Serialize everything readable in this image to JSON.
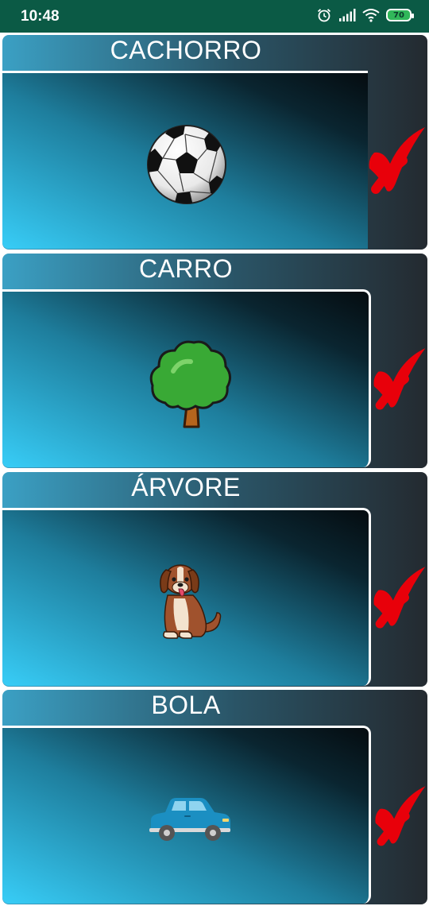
{
  "status_bar": {
    "time": "10:48",
    "battery_level": "70",
    "icons": [
      "alarm-icon",
      "signal-icon",
      "wifi-icon",
      "battery-icon"
    ]
  },
  "cards": [
    {
      "title": "CACHORRO",
      "image": "soccer-ball",
      "result": "incorrect"
    },
    {
      "title": "CARRO",
      "image": "tree",
      "result": "incorrect"
    },
    {
      "title": "ÁRVORE",
      "image": "dog",
      "result": "incorrect"
    },
    {
      "title": "BOLA",
      "image": "car",
      "result": "incorrect"
    }
  ],
  "colors": {
    "status_bar": "#0b5a45",
    "gradient_light": "#38cdf7",
    "gradient_dark": "#050c10",
    "wrong_mark": "#e8000a"
  }
}
